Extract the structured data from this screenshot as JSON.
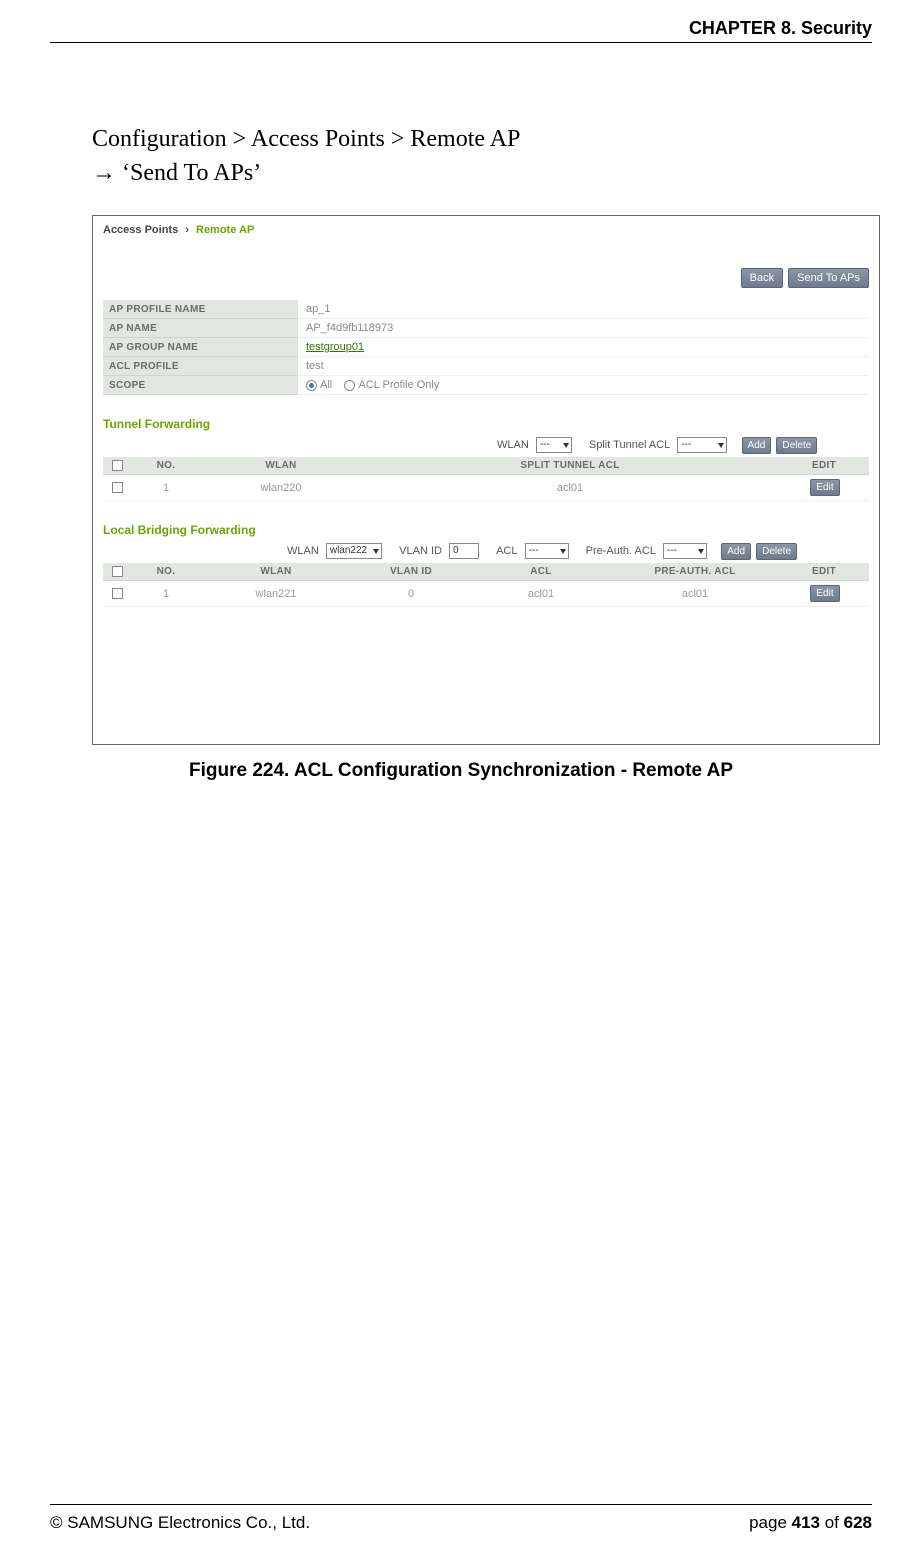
{
  "header": {
    "chapter": "CHAPTER 8. Security"
  },
  "body": {
    "line1": "Configuration > Access Points > Remote AP",
    "arrow": "→",
    "line2_rest": " ‘Send To APs’"
  },
  "screenshot": {
    "breadcrumb": {
      "root": "Access Points",
      "sep": "›",
      "current": "Remote AP"
    },
    "buttons": {
      "back": "Back",
      "send": "Send To APs",
      "add": "Add",
      "delete": "Delete",
      "edit": "Edit"
    },
    "props": {
      "k_profile": "AP PROFILE NAME",
      "v_profile": "ap_1",
      "k_name": "AP NAME",
      "v_name": "AP_f4d9fb118973",
      "k_group": "AP GROUP NAME",
      "v_group": "testgroup01",
      "k_acl": "ACL PROFILE",
      "v_acl": "test",
      "k_scope": "SCOPE",
      "scope_all": "All",
      "scope_only": "ACL Profile Only"
    },
    "tunnel": {
      "title": "Tunnel Forwarding",
      "lbl_wlan": "WLAN",
      "sel_wlan": "---",
      "lbl_split": "Split Tunnel ACL",
      "sel_split": "---",
      "cols": {
        "no": "NO.",
        "wlan": "WLAN",
        "split": "SPLIT TUNNEL ACL",
        "edit": "EDIT"
      },
      "row": {
        "no": "1",
        "wlan": "wlan220",
        "split": "acl01"
      }
    },
    "bridge": {
      "title": "Local Bridging Forwarding",
      "lbl_wlan": "WLAN",
      "sel_wlan": "wlan222",
      "lbl_vlan": "VLAN ID",
      "val_vlan": "0",
      "lbl_acl": "ACL",
      "sel_acl": "---",
      "lbl_pre": "Pre-Auth. ACL",
      "sel_pre": "---",
      "cols": {
        "no": "NO.",
        "wlan": "WLAN",
        "vlan": "VLAN ID",
        "acl": "ACL",
        "pre": "PRE-AUTH. ACL",
        "edit": "EDIT"
      },
      "row": {
        "no": "1",
        "wlan": "wlan221",
        "vlan": "0",
        "acl": "acl01",
        "pre": "acl01"
      }
    }
  },
  "caption": "Figure 224. ACL Configuration Synchronization - Remote AP",
  "footer": {
    "left": "© SAMSUNG Electronics Co., Ltd.",
    "right_prefix": "page ",
    "right_page": "413",
    "right_mid": " of ",
    "right_total": "628"
  }
}
